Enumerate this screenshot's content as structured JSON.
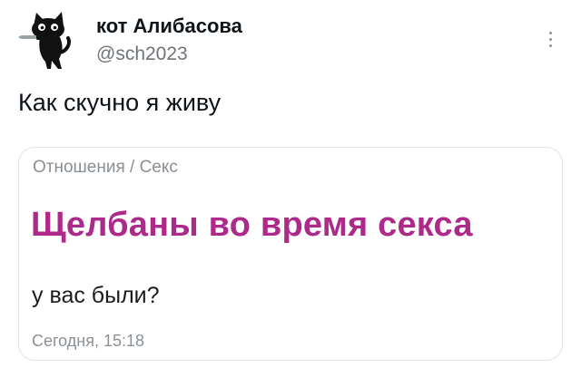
{
  "tweet": {
    "author": {
      "display_name": "кот Алибасова",
      "handle": "@sch2023",
      "avatar_icon": "black-cat-with-knife-icon"
    },
    "more_icon": "vertical-ellipsis-icon",
    "text": "Как скучно я живу",
    "link_card": {
      "breadcrumb": "Отношения / Секс",
      "title": "Щелбаны во время секса",
      "title_color": "#ad2a8a",
      "body": "у вас были?",
      "timestamp": "Сегодня, 15:18"
    }
  }
}
